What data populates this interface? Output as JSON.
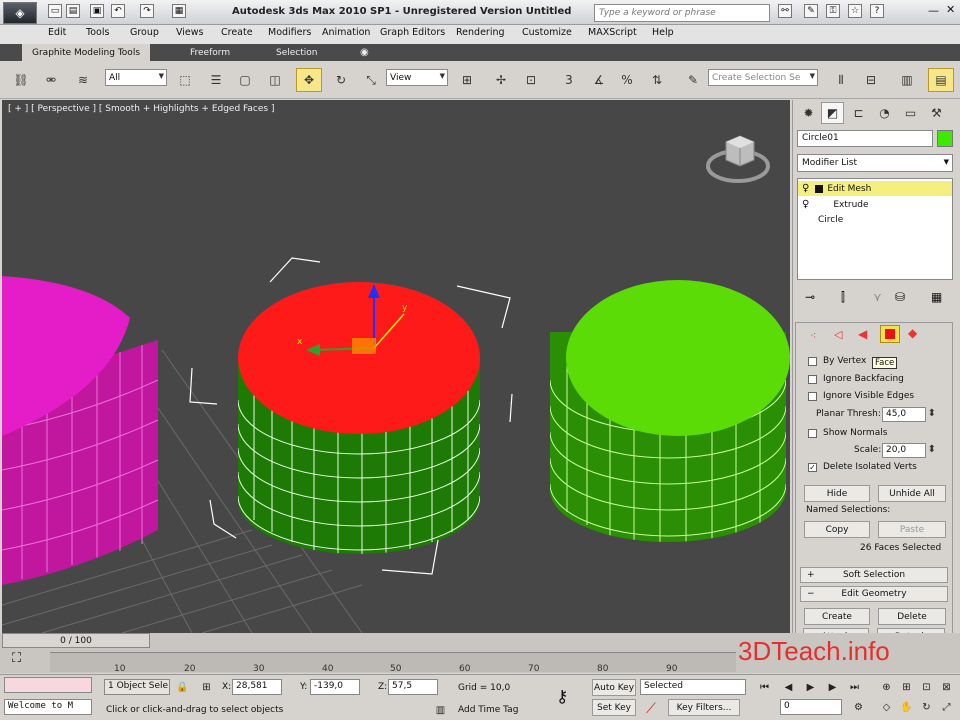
{
  "window": {
    "title": "Autodesk 3ds Max  2010 SP1   -  Unregistered Version    Untitled",
    "search_placeholder": "Type a keyword or phrase",
    "logo_text": "◈"
  },
  "menu": [
    "Edit",
    "Tools",
    "Group",
    "Views",
    "Create",
    "Modifiers",
    "Animation",
    "Graph Editors",
    "Rendering",
    "Customize",
    "MAXScript",
    "Help"
  ],
  "ribbon_tabs": [
    "Graphite Modeling Tools",
    "Freeform",
    "Selection"
  ],
  "main_toolbar": {
    "selection_filter": "All",
    "ref_coord": "View",
    "named_selection_placeholder": "Create Selection Se",
    "snap_label": "3",
    "angle_label": "%"
  },
  "viewport": {
    "label": "[ + ] [ Perspective ] [ Smooth + Highlights + Edged Faces ]",
    "gizmo_x": "x",
    "gizmo_y": "y"
  },
  "command_panel": {
    "object_name": "Circle01",
    "object_color": "#3ee800",
    "modifier_list": "Modifier List",
    "stack": [
      "Edit Mesh",
      "Extrude",
      "Circle"
    ],
    "tooltip": "Face",
    "selection": {
      "by_vertex": "By Vertex",
      "ignore_backfacing": "Ignore Backfacing",
      "ignore_visible_edges": "Ignore Visible Edges",
      "planar_thresh_label": "Planar Thresh:",
      "planar_thresh_value": "45,0",
      "show_normals": "Show Normals",
      "scale_label": "Scale:",
      "scale_value": "20,0",
      "delete_isolated": "Delete Isolated Verts",
      "hide": "Hide",
      "unhide_all": "Unhide All",
      "named_selections": "Named Selections:",
      "copy": "Copy",
      "paste": "Paste",
      "faces_selected": "26 Faces Selected"
    },
    "rollouts": {
      "soft_selection": "Soft Selection",
      "edit_geometry": "Edit Geometry",
      "create": "Create",
      "delete": "Delete",
      "attach": "Attach",
      "detach": "Detach"
    }
  },
  "timeline": {
    "frame": "0 / 100",
    "ticks": [
      "10",
      "20",
      "30",
      "40",
      "50",
      "60",
      "70",
      "80",
      "90"
    ]
  },
  "status": {
    "maxscript": "Welcome to M",
    "objects_selected": "1 Object Sele",
    "x_label": "X:",
    "x_value": "28,581",
    "y_label": "Y:",
    "y_value": "-139,0",
    "z_label": "Z:",
    "z_value": "57,5",
    "grid": "Grid = 10,0",
    "prompt": "Click or click-and-drag to select objects",
    "add_time_tag": "Add Time Tag",
    "auto_key": "Auto Key",
    "set_key": "Set Key",
    "selected": "Selected",
    "key_filters": "Key Filters...",
    "frame_field": "0"
  },
  "watermark": "3DTeach.info",
  "colors": {
    "selected_face": "#ff1a1a",
    "mesh_green": "#55dd00",
    "mesh_magenta": "#e020c0",
    "viewport_bg": "#474747"
  }
}
